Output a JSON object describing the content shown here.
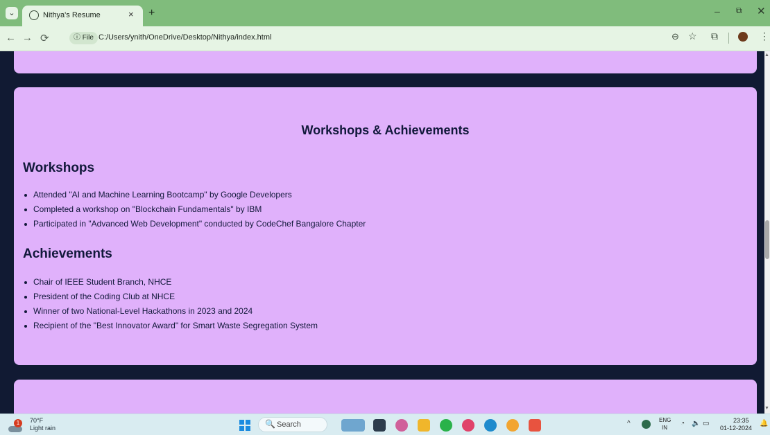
{
  "browser": {
    "tab_title": "Nithya's Resume",
    "tab_close": "×",
    "new_tab": "+",
    "tab_menu": "⌄",
    "url_chip": "ⓘ File",
    "url": "C:/Users/ynith/OneDrive/Desktop/Nithya/index.html",
    "window_controls": {
      "minimize": "–",
      "maximize": "⧉",
      "close": "✕"
    },
    "nav": {
      "back": "←",
      "forward": "→",
      "reload": "⟳"
    },
    "toolbar_icons": {
      "zoom": "⊖",
      "star": "☆",
      "extensions": "⧉",
      "menu": "⋮"
    }
  },
  "page": {
    "section_title": "Workshops & Achievements",
    "workshops": {
      "heading": "Workshops",
      "items": [
        "Attended \"AI and Machine Learning Bootcamp\" by Google Developers",
        "Completed a workshop on \"Blockchain Fundamentals\" by IBM",
        "Participated in \"Advanced Web Development\" conducted by CodeChef Bangalore Chapter"
      ]
    },
    "achievements": {
      "heading": "Achievements",
      "items": [
        "Chair of IEEE Student Branch, NHCE",
        "President of the Coding Club at NHCE",
        "Winner of two National-Level Hackathons in 2023 and 2024",
        "Recipient of the \"Best Innovator Award\" for Smart Waste Segregation System"
      ]
    }
  },
  "taskbar": {
    "weather_badge": "1",
    "weather_temp": "70°F",
    "weather_condition": "Light rain",
    "search_placeholder": "Search",
    "search_glyph": "🔍",
    "tray_up": "^",
    "language_line1": "ENG",
    "language_line2": "IN",
    "wifi": "◔",
    "volume": "🔈",
    "battery": "▭",
    "time": "23:35",
    "date": "01-12-2024",
    "notification": "🔔",
    "apps": [
      "cloud-app-icon",
      "file-explorer-icon",
      "copilot-icon",
      "folder-icon",
      "whatsapp-icon",
      "app-icon",
      "edge-icon",
      "chrome-icon",
      "brave-icon"
    ]
  },
  "colors": {
    "tab_strip": "#80bc7c",
    "toolbar": "#e6f4e4",
    "page_background": "#111a33",
    "card": "#e0b1fb",
    "text": "#11183a"
  }
}
